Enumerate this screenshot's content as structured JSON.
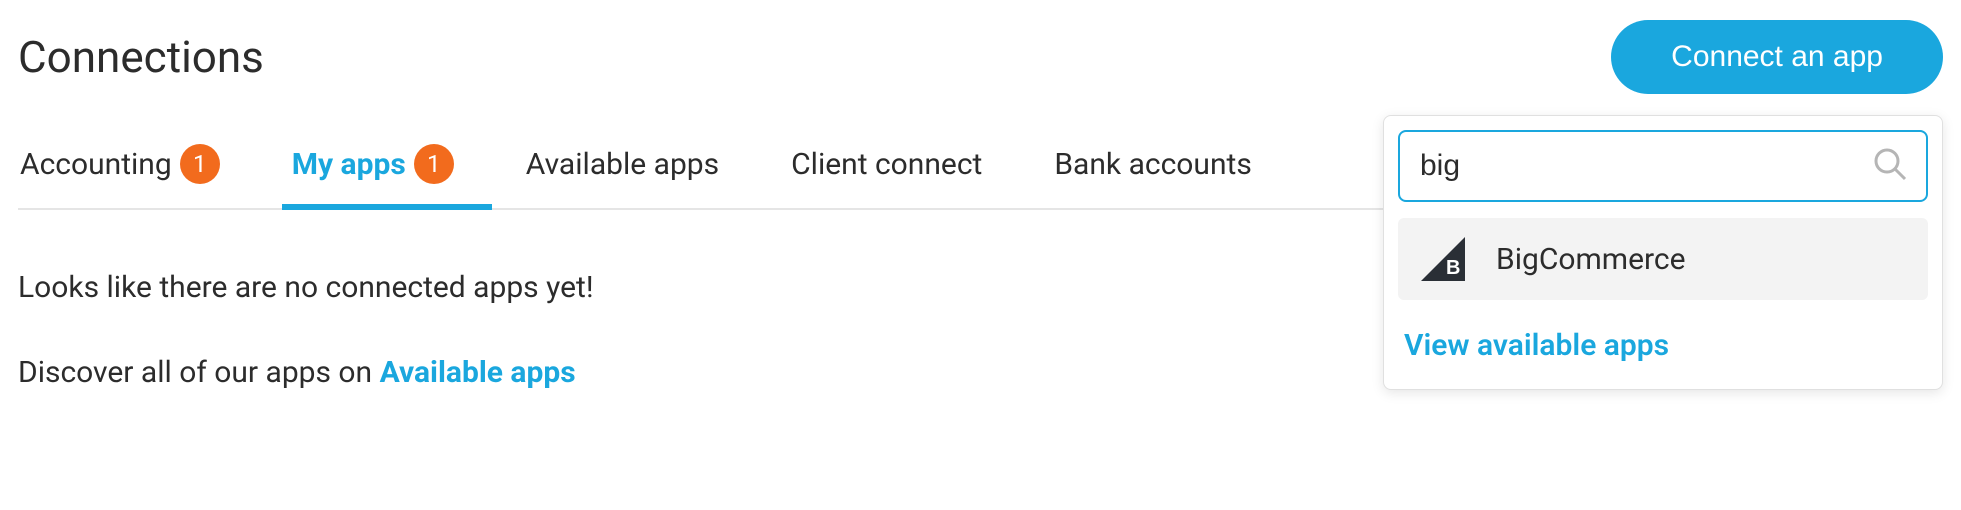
{
  "header": {
    "title": "Connections",
    "connect_button": "Connect an app"
  },
  "tabs": {
    "items": [
      {
        "label": "Accounting",
        "badge": "1"
      },
      {
        "label": "My apps",
        "badge": "1"
      },
      {
        "label": "Available apps"
      },
      {
        "label": "Client connect"
      },
      {
        "label": "Bank accounts"
      }
    ]
  },
  "content": {
    "empty_message": "Looks like there are no connected apps yet!",
    "discover_prefix": "Discover all of our apps on ",
    "discover_link": "Available apps"
  },
  "search": {
    "value": "big",
    "results": [
      {
        "name": "BigCommerce"
      }
    ],
    "view_all": "View available apps"
  }
}
